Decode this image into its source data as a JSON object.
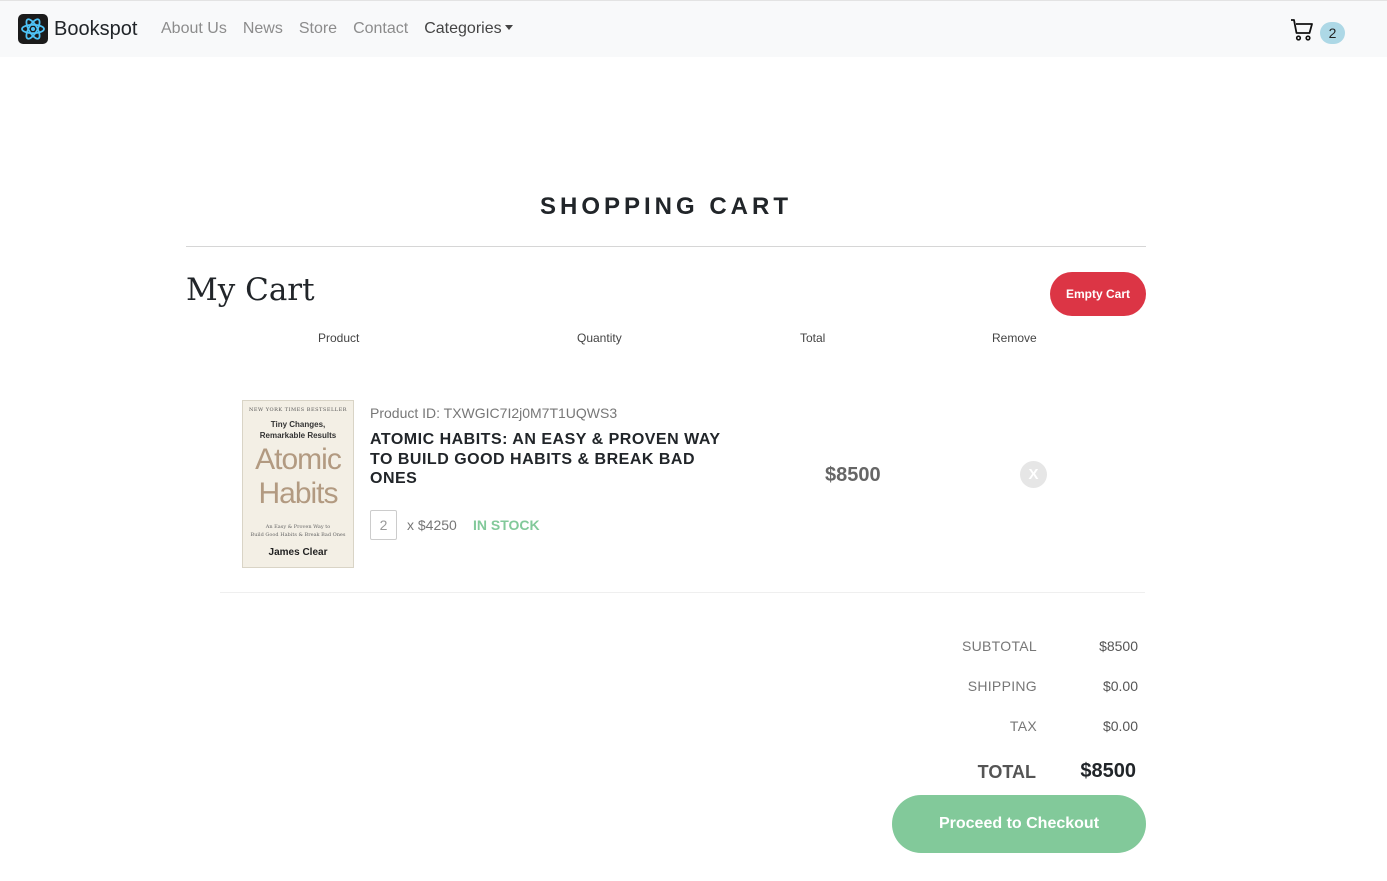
{
  "nav": {
    "brand": "Bookspot",
    "links": [
      "About Us",
      "News",
      "Store",
      "Contact"
    ],
    "categories": "Categories",
    "cart_count": "2"
  },
  "page": {
    "title": "SHOPPING CART",
    "section_title": "My Cart",
    "empty_cart": "Empty Cart"
  },
  "columns": [
    "Product",
    "Quantity",
    "Total",
    "Remove"
  ],
  "item": {
    "product_id": "Product ID: TXWGIC7I2j0M7T1UQWS3",
    "name": "ATOMIC HABITS: AN EASY & PROVEN WAY TO BUILD GOOD HABITS & BREAK BAD ONES",
    "quantity": "2",
    "unit_price": "x $4250",
    "stock": "IN STOCK",
    "line_total": "$8500",
    "remove": "X",
    "cover": {
      "badge": "NEW YORK TIMES BESTSELLER",
      "subtitle1": "Tiny Changes,",
      "subtitle2": "Remarkable Results",
      "title1": "Atomic",
      "title2": "Habits",
      "tagline1": "An Easy & Proven Way to",
      "tagline2": "Build Good Habits & Break Bad Ones",
      "author": "James Clear"
    }
  },
  "summary": {
    "subtotal_label": "SUBTOTAL",
    "subtotal": "$8500",
    "shipping_label": "SHIPPING",
    "shipping": "$0.00",
    "tax_label": "TAX",
    "tax": "$0.00",
    "total_label": "TOTAL",
    "total": "$8500"
  },
  "checkout": "Proceed to Checkout",
  "colors": {
    "accent_green": "#82c99a",
    "danger": "#dc3545",
    "badge": "#add8e6"
  }
}
